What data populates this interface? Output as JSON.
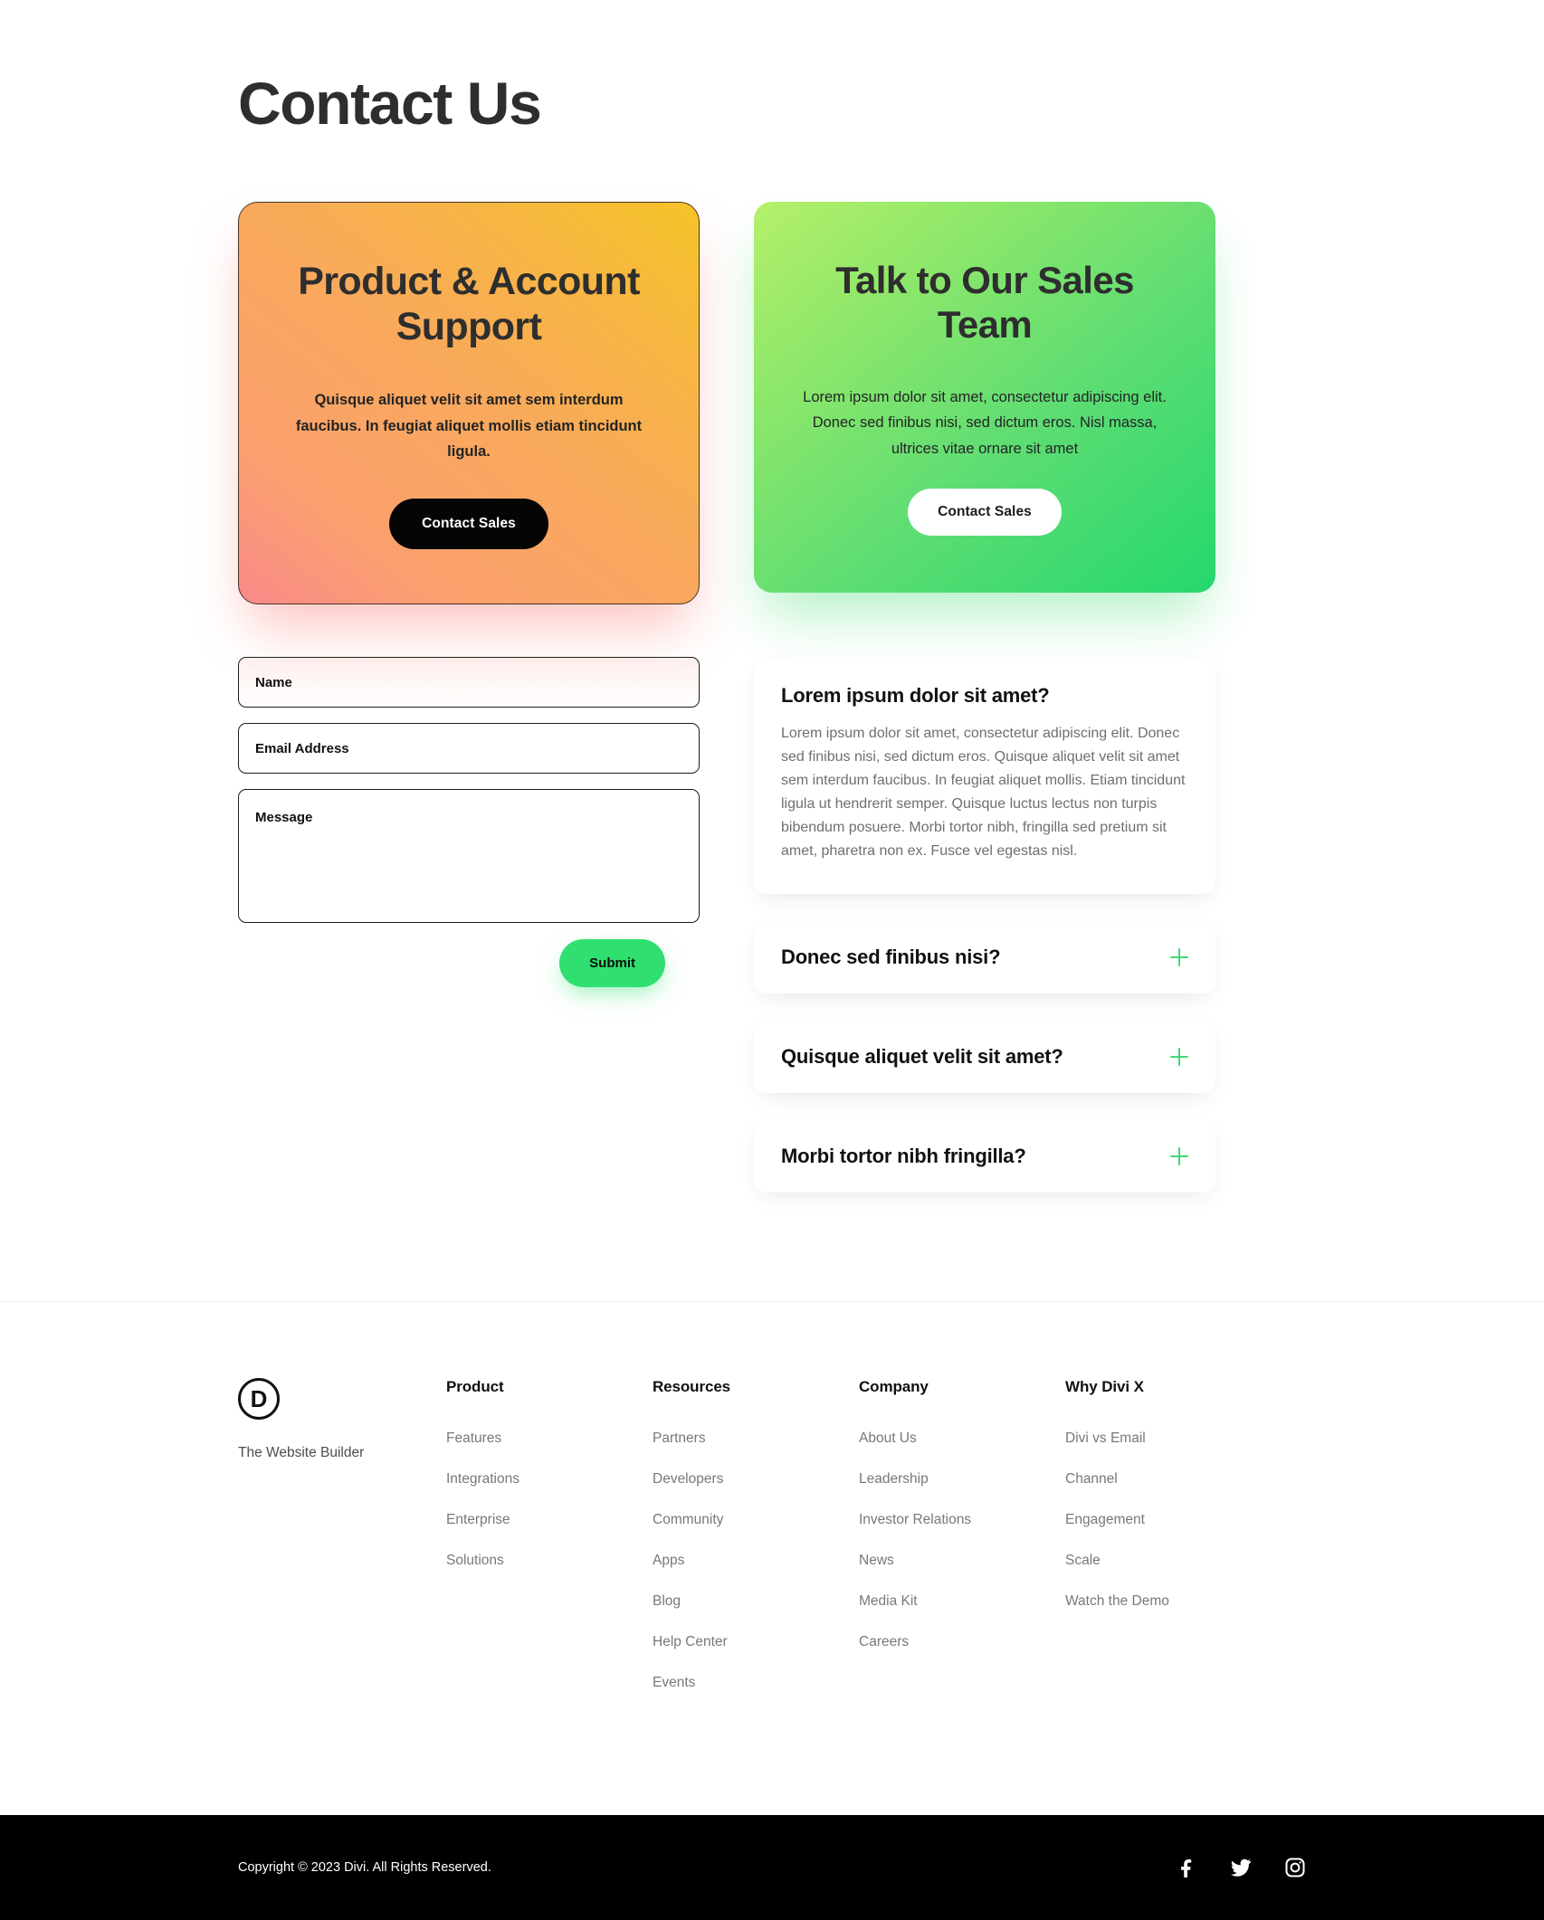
{
  "page": {
    "title": "Contact Us"
  },
  "cards": [
    {
      "id": "support",
      "title": "Product & Account Support",
      "body": "Quisque aliquet velit sit amet sem interdum faucibus. In feugiat aliquet mollis etiam tincidunt ligula.",
      "button_label": "Contact Sales",
      "gradient_from": "#f98a8a",
      "gradient_to": "#f6c328",
      "button_bg": "#050505",
      "button_color": "#ffffff"
    },
    {
      "id": "sales",
      "title": "Talk to Our Sales Team",
      "body": "Lorem ipsum dolor sit amet, consectetur adipiscing elit. Donec sed finibus nisi, sed dictum eros. Nisl massa, ultrices vitae ornare sit amet",
      "button_label": "Contact Sales",
      "gradient_from": "#b5f06a",
      "gradient_to": "#24d86d",
      "button_bg": "#ffffff",
      "button_color": "#1c1c1c"
    }
  ],
  "form": {
    "name_placeholder": "Name",
    "email_placeholder": "Email Address",
    "message_placeholder": "Message",
    "name_value": "",
    "email_value": "",
    "message_value": "",
    "submit_label": "Submit",
    "submit_bg": "#2fe070"
  },
  "faq": {
    "open_item": {
      "question": "Lorem ipsum dolor sit amet?",
      "answer": "Lorem ipsum dolor sit amet, consectetur adipiscing elit. Donec sed finibus nisi, sed dictum eros. Quisque aliquet velit sit amet sem interdum faucibus. In feugiat aliquet mollis. Etiam tincidunt ligula ut hendrerit semper. Quisque luctus lectus non turpis bibendum posuere. Morbi tortor nibh, fringilla sed pretium sit amet, pharetra non ex. Fusce vel egestas nisl."
    },
    "toggle_icon": "plus-icon",
    "toggle_color": "#3fd977",
    "collapsed_items": [
      {
        "question": "Donec sed finibus nisi?"
      },
      {
        "question": "Quisque aliquet velit sit amet?"
      },
      {
        "question": "Morbi tortor nibh fringilla?"
      }
    ]
  },
  "footer": {
    "brand": {
      "logo_letter": "D",
      "tagline": "The Website Builder"
    },
    "columns": [
      {
        "heading": "Product",
        "links": [
          "Features",
          "Integrations",
          "Enterprise",
          "Solutions"
        ]
      },
      {
        "heading": "Resources",
        "links": [
          "Partners",
          "Developers",
          "Community",
          "Apps",
          "Blog",
          "Help Center",
          "Events"
        ]
      },
      {
        "heading": "Company",
        "links": [
          "About Us",
          "Leadership",
          "Investor Relations",
          "News",
          "Media Kit",
          "Careers"
        ]
      },
      {
        "heading": "Why Divi X",
        "links": [
          "Divi vs Email",
          "Channel",
          "Engagement",
          "Scale",
          "Watch the Demo"
        ]
      }
    ],
    "bottom": {
      "copyright": "Copyright © 2023 Divi. All Rights Reserved.",
      "socials": [
        "facebook-icon",
        "twitter-icon",
        "instagram-icon"
      ]
    }
  }
}
